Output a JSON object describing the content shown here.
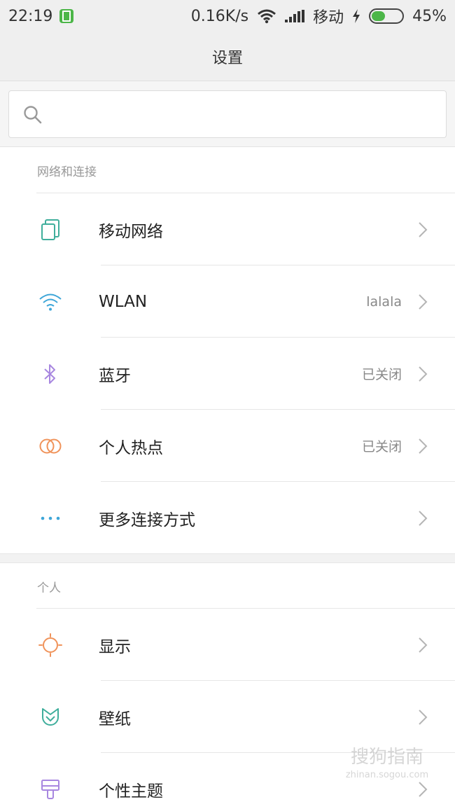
{
  "status_bar": {
    "time": "22:19",
    "speed": "0.16K/s",
    "carrier": "移动",
    "battery": "45%"
  },
  "header": {
    "title": "设置"
  },
  "search": {
    "placeholder": ""
  },
  "sections": [
    {
      "title": "网络和连接",
      "items": [
        {
          "label": "移动网络",
          "value": "",
          "icon": "sim-card-icon",
          "color": "#3fae9c"
        },
        {
          "label": "WLAN",
          "value": "lalala",
          "icon": "wifi-icon",
          "color": "#3ea6d8"
        },
        {
          "label": "蓝牙",
          "value": "已关闭",
          "icon": "bluetooth-icon",
          "color": "#a887e0"
        },
        {
          "label": "个人热点",
          "value": "已关闭",
          "icon": "hotspot-icon",
          "color": "#f0935a"
        },
        {
          "label": "更多连接方式",
          "value": "",
          "icon": "more-dots-icon",
          "color": "#3ea6d8"
        }
      ]
    },
    {
      "title": "个人",
      "items": [
        {
          "label": "显示",
          "value": "",
          "icon": "sun-icon",
          "color": "#f0935a"
        },
        {
          "label": "壁纸",
          "value": "",
          "icon": "wallpaper-tulip-icon",
          "color": "#3fae9c"
        },
        {
          "label": "个性主题",
          "value": "",
          "icon": "theme-brush-icon",
          "color": "#a887e0"
        }
      ]
    }
  ],
  "watermark": {
    "main": "搜狗指南",
    "sub": "zhinan.sogou.com"
  }
}
